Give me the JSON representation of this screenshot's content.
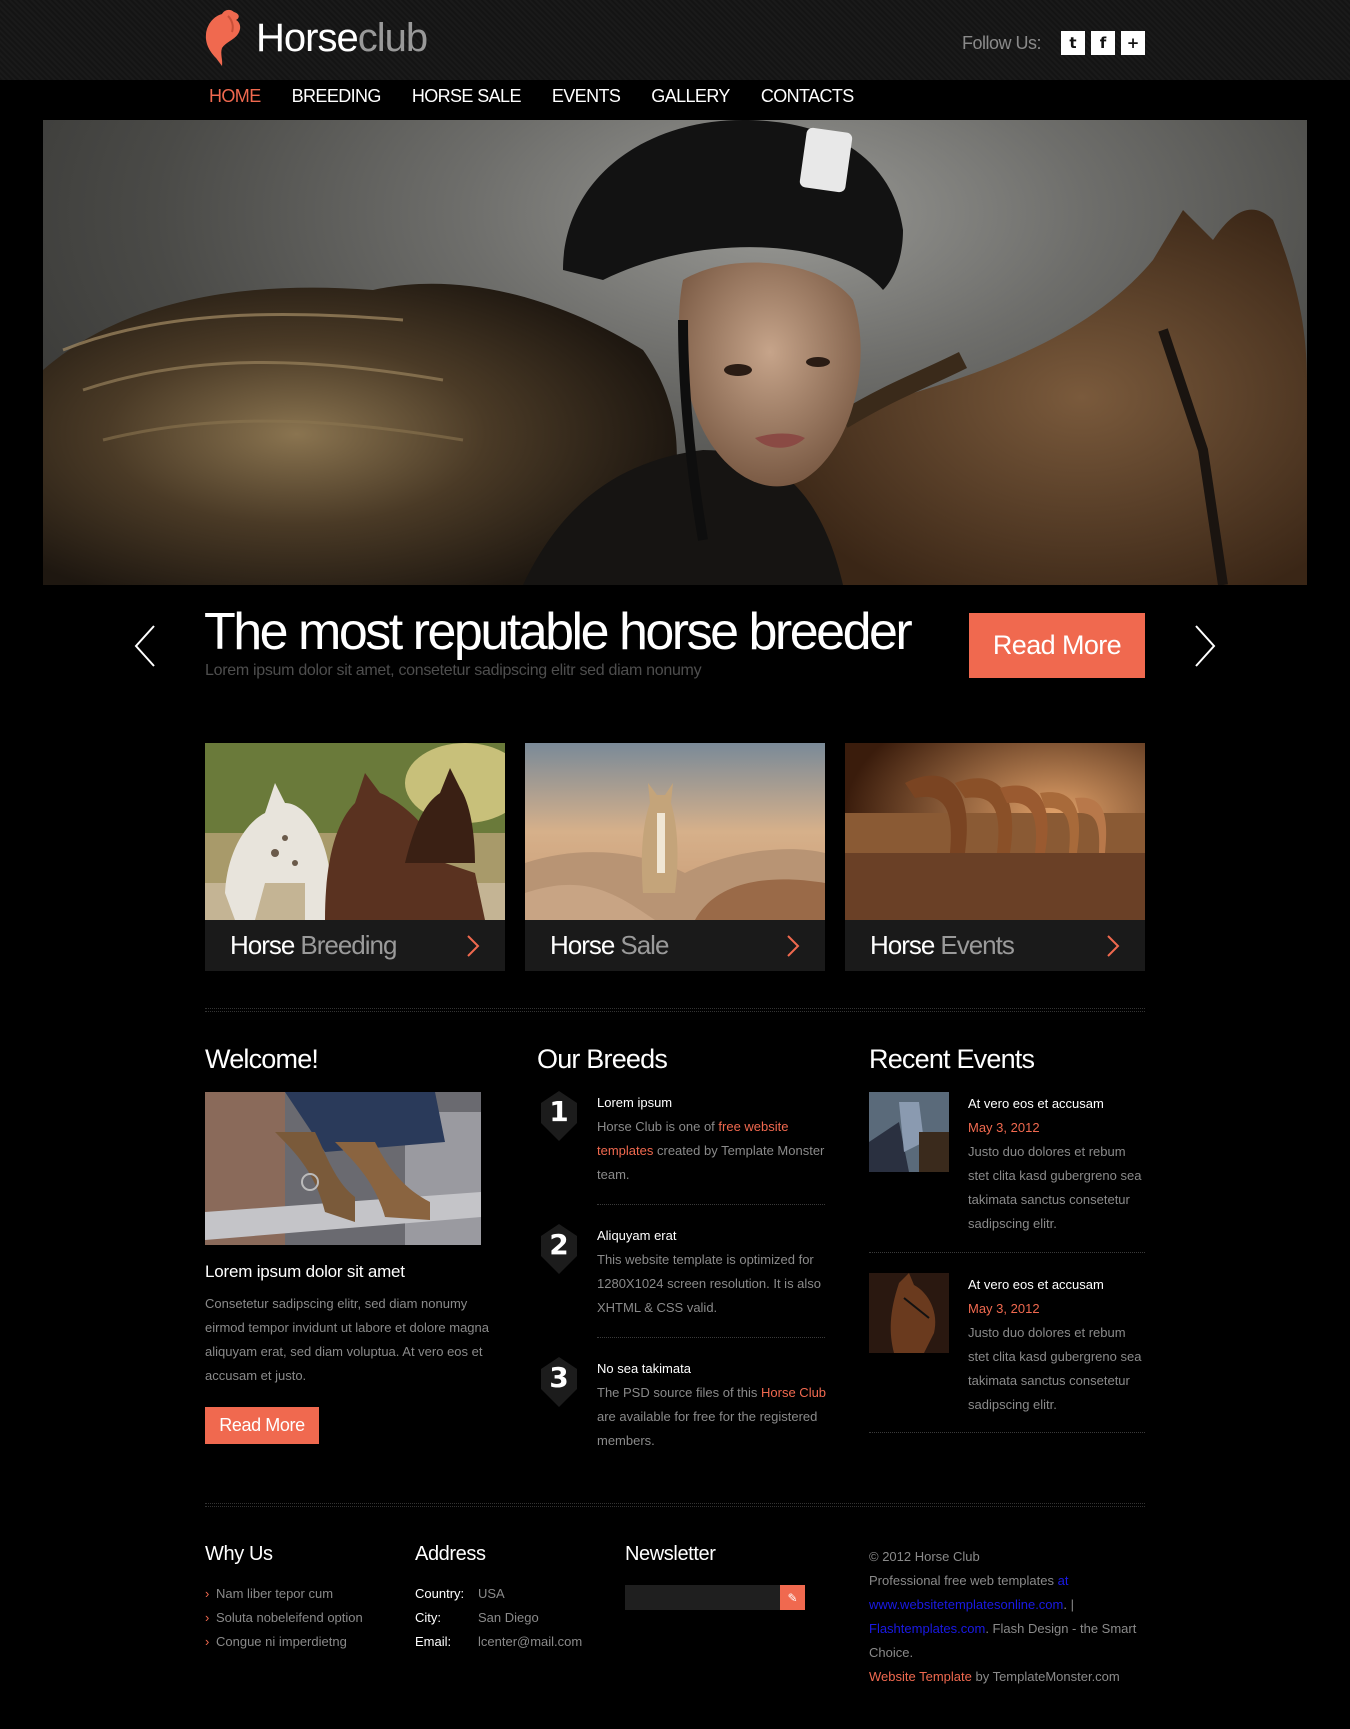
{
  "brand": {
    "name_main": "Horse",
    "name_light": "club",
    "accent_color": "#f0694f"
  },
  "follow": {
    "label": "Follow Us:",
    "icons": [
      "twitter-icon",
      "facebook-icon",
      "plus-icon"
    ]
  },
  "nav": {
    "items": [
      "HOME",
      "BREEDING",
      "HORSE SALE",
      "EVENTS",
      "GALLERY",
      "CONTACTS"
    ],
    "active": "HOME"
  },
  "hero": {
    "headline": "The most reputable horse breeder",
    "subline": "Lorem ipsum dolor sit amet, consetetur sadipscing elitr sed diam nonumy",
    "button": "Read More"
  },
  "features": [
    {
      "word1": "Horse",
      "word2": "Breeding"
    },
    {
      "word1": "Horse",
      "word2": "Sale"
    },
    {
      "word1": "Horse",
      "word2": "Events"
    }
  ],
  "welcome": {
    "title": "Welcome!",
    "heading": "Lorem ipsum dolor sit amet",
    "text": "Consetetur sadipscing elitr, sed diam nonumy eirmod tempor invidunt ut labore et dolore magna aliquyam erat, sed diam voluptua. At vero eos et accusam et justo.",
    "button": "Read More"
  },
  "breeds": {
    "title": "Our Breeds",
    "items": [
      {
        "num": "1",
        "title": "Lorem ipsum",
        "pre": "Horse Club is one of ",
        "link": "free website templates",
        "post": " created by Template Monster team."
      },
      {
        "num": "2",
        "title": "Aliquyam erat",
        "pre": "This website template is optimized for 1280X1024 screen resolution. It is also XHTML & CSS valid.",
        "link": "",
        "post": ""
      },
      {
        "num": "3",
        "title": "No sea takimata",
        "pre": "The PSD source files of this ",
        "link": "Horse Club",
        "post": " are available for free for the registered members."
      }
    ]
  },
  "events": {
    "title": "Recent Events",
    "items": [
      {
        "title": "At vero eos et accusam",
        "date": "May 3, 2012",
        "text": "Justo duo dolores et rebum stet clita kasd gubergreno sea takimata sanctus consetetur sadipscing elitr."
      },
      {
        "title": "At vero eos et accusam",
        "date": "May 3, 2012",
        "text": "Justo duo dolores et rebum stet clita kasd gubergreno sea takimata sanctus consetetur sadipscing elitr."
      }
    ]
  },
  "footer": {
    "why": {
      "title": "Why Us",
      "items": [
        "Nam liber tepor cum",
        "Soluta nobeleifend option",
        "Congue ni imperdietng"
      ]
    },
    "address": {
      "title": "Address",
      "rows": [
        {
          "k": "Country:",
          "v": "USA"
        },
        {
          "k": "City:",
          "v": "San Diego"
        },
        {
          "k": "Email:",
          "v": "lcenter@mail.com"
        }
      ]
    },
    "newsletter": {
      "title": "Newsletter",
      "placeholder": ""
    },
    "copy": {
      "line1": "© 2012 Horse Club",
      "line2": "Professional free web templates ",
      "at": "at",
      "link1": "www.websitetemplatesonline.com",
      "sep": ". |",
      "link2": "Flashtemplates.com",
      "tail": ". Flash Design - the Smart Choice.",
      "link3": "Website Template",
      "by": " by TemplateMonster.com"
    }
  }
}
